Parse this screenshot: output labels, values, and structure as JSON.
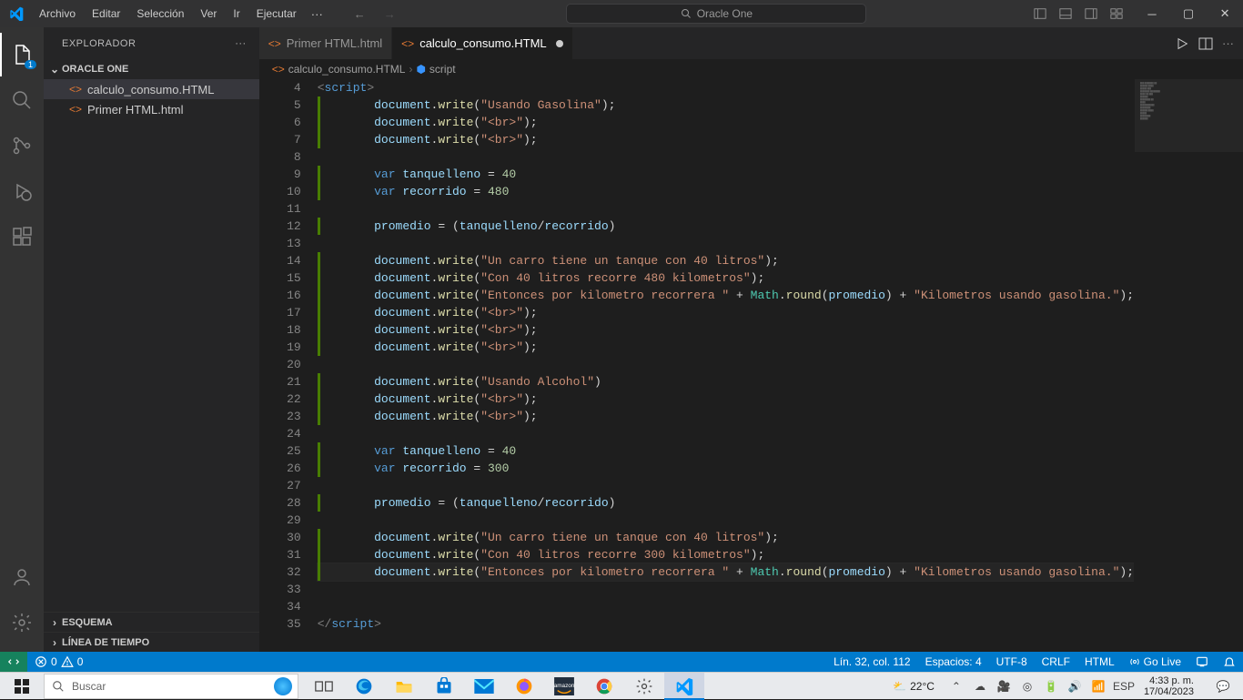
{
  "titlebar": {
    "menu": [
      "Archivo",
      "Editar",
      "Selección",
      "Ver",
      "Ir",
      "Ejecutar"
    ],
    "overflow": "···",
    "search_text": "Oracle One"
  },
  "activitybar": {
    "explorer_badge": "1"
  },
  "sidebar": {
    "title": "EXPLORADOR",
    "workspace": "ORACLE ONE",
    "files": [
      {
        "name": "calculo_consumo.HTML",
        "selected": true
      },
      {
        "name": "Primer HTML.html",
        "selected": false
      }
    ],
    "sections_bottom": [
      "ESQUEMA",
      "LÍNEA DE TIEMPO"
    ]
  },
  "tabs": {
    "items": [
      {
        "label": "Primer HTML.html",
        "active": false,
        "dirty": false
      },
      {
        "label": "calculo_consumo.HTML",
        "active": true,
        "dirty": true
      }
    ]
  },
  "breadcrumbs": {
    "file": "calculo_consumo.HTML",
    "symbol": "script"
  },
  "code": {
    "first_line": 4,
    "current_line": 32,
    "lines": [
      {
        "n": 4,
        "i": 0,
        "t": [
          [
            "tag",
            "<"
          ],
          [
            "tagname",
            "script"
          ],
          [
            "tag",
            ">"
          ]
        ]
      },
      {
        "n": 5,
        "i": 2,
        "t": [
          [
            "obj",
            "document"
          ],
          [
            "punc",
            "."
          ],
          [
            "fn",
            "write"
          ],
          [
            "punc",
            "("
          ],
          [
            "str",
            "\"Usando Gasolina\""
          ],
          [
            "punc",
            ");"
          ]
        ]
      },
      {
        "n": 6,
        "i": 2,
        "t": [
          [
            "obj",
            "document"
          ],
          [
            "punc",
            "."
          ],
          [
            "fn",
            "write"
          ],
          [
            "punc",
            "("
          ],
          [
            "str",
            "\"<br>\""
          ],
          [
            "punc",
            ");"
          ]
        ]
      },
      {
        "n": 7,
        "i": 2,
        "t": [
          [
            "obj",
            "document"
          ],
          [
            "punc",
            "."
          ],
          [
            "fn",
            "write"
          ],
          [
            "punc",
            "("
          ],
          [
            "str",
            "\"<br>\""
          ],
          [
            "punc",
            ");"
          ]
        ]
      },
      {
        "n": 8,
        "i": 2,
        "t": []
      },
      {
        "n": 9,
        "i": 2,
        "t": [
          [
            "kw",
            "var"
          ],
          [
            "punc",
            " "
          ],
          [
            "var",
            "tanquelleno"
          ],
          [
            "punc",
            " = "
          ],
          [
            "num",
            "40"
          ]
        ]
      },
      {
        "n": 10,
        "i": 2,
        "t": [
          [
            "kw",
            "var"
          ],
          [
            "punc",
            " "
          ],
          [
            "var",
            "recorrido"
          ],
          [
            "punc",
            " = "
          ],
          [
            "num",
            "480"
          ]
        ]
      },
      {
        "n": 11,
        "i": 2,
        "t": []
      },
      {
        "n": 12,
        "i": 2,
        "t": [
          [
            "var",
            "promedio"
          ],
          [
            "punc",
            " = ("
          ],
          [
            "var",
            "tanquelleno"
          ],
          [
            "punc",
            "/"
          ],
          [
            "var",
            "recorrido"
          ],
          [
            "punc",
            ")"
          ]
        ]
      },
      {
        "n": 13,
        "i": 2,
        "t": []
      },
      {
        "n": 14,
        "i": 2,
        "t": [
          [
            "obj",
            "document"
          ],
          [
            "punc",
            "."
          ],
          [
            "fn",
            "write"
          ],
          [
            "punc",
            "("
          ],
          [
            "str",
            "\"Un carro tiene un tanque con 40 litros\""
          ],
          [
            "punc",
            ");"
          ]
        ]
      },
      {
        "n": 15,
        "i": 2,
        "t": [
          [
            "obj",
            "document"
          ],
          [
            "punc",
            "."
          ],
          [
            "fn",
            "write"
          ],
          [
            "punc",
            "("
          ],
          [
            "str",
            "\"Con 40 litros recorre 480 kilometros\""
          ],
          [
            "punc",
            ");"
          ]
        ]
      },
      {
        "n": 16,
        "i": 2,
        "t": [
          [
            "obj",
            "document"
          ],
          [
            "punc",
            "."
          ],
          [
            "fn",
            "write"
          ],
          [
            "punc",
            "("
          ],
          [
            "str",
            "\"Entonces por kilometro recorrera \""
          ],
          [
            "punc",
            " + "
          ],
          [
            "class",
            "Math"
          ],
          [
            "punc",
            "."
          ],
          [
            "fn",
            "round"
          ],
          [
            "punc",
            "("
          ],
          [
            "var",
            "promedio"
          ],
          [
            "punc",
            ") + "
          ],
          [
            "str",
            "\"Kilometros usando gasolina.\""
          ],
          [
            "punc",
            ");"
          ]
        ]
      },
      {
        "n": 17,
        "i": 2,
        "t": [
          [
            "obj",
            "document"
          ],
          [
            "punc",
            "."
          ],
          [
            "fn",
            "write"
          ],
          [
            "punc",
            "("
          ],
          [
            "str",
            "\"<br>\""
          ],
          [
            "punc",
            ");"
          ]
        ]
      },
      {
        "n": 18,
        "i": 2,
        "t": [
          [
            "obj",
            "document"
          ],
          [
            "punc",
            "."
          ],
          [
            "fn",
            "write"
          ],
          [
            "punc",
            "("
          ],
          [
            "str",
            "\"<br>\""
          ],
          [
            "punc",
            ");"
          ]
        ]
      },
      {
        "n": 19,
        "i": 2,
        "t": [
          [
            "obj",
            "document"
          ],
          [
            "punc",
            "."
          ],
          [
            "fn",
            "write"
          ],
          [
            "punc",
            "("
          ],
          [
            "str",
            "\"<br>\""
          ],
          [
            "punc",
            ");"
          ]
        ]
      },
      {
        "n": 20,
        "i": 2,
        "t": []
      },
      {
        "n": 21,
        "i": 2,
        "t": [
          [
            "obj",
            "document"
          ],
          [
            "punc",
            "."
          ],
          [
            "fn",
            "write"
          ],
          [
            "punc",
            "("
          ],
          [
            "str",
            "\"Usando Alcohol\""
          ],
          [
            "punc",
            ")"
          ]
        ]
      },
      {
        "n": 22,
        "i": 2,
        "t": [
          [
            "obj",
            "document"
          ],
          [
            "punc",
            "."
          ],
          [
            "fn",
            "write"
          ],
          [
            "punc",
            "("
          ],
          [
            "str",
            "\"<br>\""
          ],
          [
            "punc",
            ");"
          ]
        ]
      },
      {
        "n": 23,
        "i": 2,
        "t": [
          [
            "obj",
            "document"
          ],
          [
            "punc",
            "."
          ],
          [
            "fn",
            "write"
          ],
          [
            "punc",
            "("
          ],
          [
            "str",
            "\"<br>\""
          ],
          [
            "punc",
            ");"
          ]
        ]
      },
      {
        "n": 24,
        "i": 2,
        "t": []
      },
      {
        "n": 25,
        "i": 2,
        "t": [
          [
            "kw",
            "var"
          ],
          [
            "punc",
            " "
          ],
          [
            "var",
            "tanquelleno"
          ],
          [
            "punc",
            " = "
          ],
          [
            "num",
            "40"
          ]
        ]
      },
      {
        "n": 26,
        "i": 2,
        "t": [
          [
            "kw",
            "var"
          ],
          [
            "punc",
            " "
          ],
          [
            "var",
            "recorrido"
          ],
          [
            "punc",
            " = "
          ],
          [
            "num",
            "300"
          ]
        ]
      },
      {
        "n": 27,
        "i": 2,
        "t": []
      },
      {
        "n": 28,
        "i": 2,
        "t": [
          [
            "var",
            "promedio"
          ],
          [
            "punc",
            " = ("
          ],
          [
            "var",
            "tanquelleno"
          ],
          [
            "punc",
            "/"
          ],
          [
            "var",
            "recorrido"
          ],
          [
            "punc",
            ")"
          ]
        ]
      },
      {
        "n": 29,
        "i": 2,
        "t": []
      },
      {
        "n": 30,
        "i": 2,
        "t": [
          [
            "obj",
            "document"
          ],
          [
            "punc",
            "."
          ],
          [
            "fn",
            "write"
          ],
          [
            "punc",
            "("
          ],
          [
            "str",
            "\"Un carro tiene un tanque con 40 litros\""
          ],
          [
            "punc",
            ");"
          ]
        ]
      },
      {
        "n": 31,
        "i": 2,
        "t": [
          [
            "obj",
            "document"
          ],
          [
            "punc",
            "."
          ],
          [
            "fn",
            "write"
          ],
          [
            "punc",
            "("
          ],
          [
            "str",
            "\"Con 40 litros recorre 300 kilometros\""
          ],
          [
            "punc",
            ");"
          ]
        ]
      },
      {
        "n": 32,
        "i": 2,
        "t": [
          [
            "obj",
            "document"
          ],
          [
            "punc",
            "."
          ],
          [
            "fn",
            "write"
          ],
          [
            "punc",
            "("
          ],
          [
            "str",
            "\"Entonces por kilometro recorrera \""
          ],
          [
            "punc",
            " + "
          ],
          [
            "class",
            "Math"
          ],
          [
            "punc",
            "."
          ],
          [
            "fn",
            "round"
          ],
          [
            "punc",
            "("
          ],
          [
            "var",
            "promedio"
          ],
          [
            "punc",
            ") + "
          ],
          [
            "str",
            "\"Kilometros usando gasolina.\""
          ],
          [
            "punc",
            ");"
          ]
        ]
      },
      {
        "n": 33,
        "i": 2,
        "t": []
      },
      {
        "n": 34,
        "i": 2,
        "t": []
      },
      {
        "n": 35,
        "i": 0,
        "t": [
          [
            "tag",
            "</"
          ],
          [
            "tagname",
            "script"
          ],
          [
            "tag",
            ">"
          ]
        ]
      }
    ]
  },
  "statusbar": {
    "errors": "0",
    "warnings": "0",
    "line_col": "Lín. 32, col. 112",
    "spaces": "Espacios: 4",
    "encoding": "UTF-8",
    "eol": "CRLF",
    "lang": "HTML",
    "golive": "Go Live"
  },
  "taskbar": {
    "search_placeholder": "Buscar",
    "weather_temp": "22°C",
    "lang": "ESP",
    "time": "4:33 p. m.",
    "date": "17/04/2023"
  }
}
